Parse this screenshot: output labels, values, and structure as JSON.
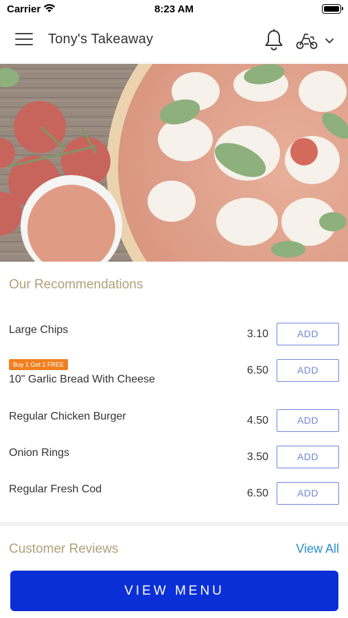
{
  "status_bar": {
    "carrier": "Carrier",
    "time": "8:23 AM"
  },
  "header": {
    "title": "Tony's Takeaway",
    "icons": [
      "menu-icon",
      "bell-icon",
      "delivery-scooter-icon",
      "chevron-down-icon"
    ]
  },
  "recommendations": {
    "title": "Our Recommendations",
    "items": [
      {
        "name": "Large Chips",
        "price": "3.10",
        "button": "ADD",
        "badge": ""
      },
      {
        "name": "10\" Garlic Bread With Cheese",
        "price": "6.50",
        "button": "ADD",
        "badge": "Buy 1 Get 1 FREE"
      },
      {
        "name": "Regular Chicken Burger",
        "price": "4.50",
        "button": "ADD",
        "badge": ""
      },
      {
        "name": "Onion Rings",
        "price": "3.50",
        "button": "ADD",
        "badge": ""
      },
      {
        "name": "Regular Fresh Cod",
        "price": "6.50",
        "button": "ADD",
        "badge": ""
      }
    ]
  },
  "reviews": {
    "title": "Customer Reviews",
    "view_all": "View All"
  },
  "footer": {
    "view_menu": "VIEW MENU"
  },
  "colors": {
    "accent_blue": "#0a2fd6",
    "add_button": "#6f86d6",
    "section_title": "#b0a07a",
    "badge": "#f08020",
    "link": "#2a8fd0"
  }
}
